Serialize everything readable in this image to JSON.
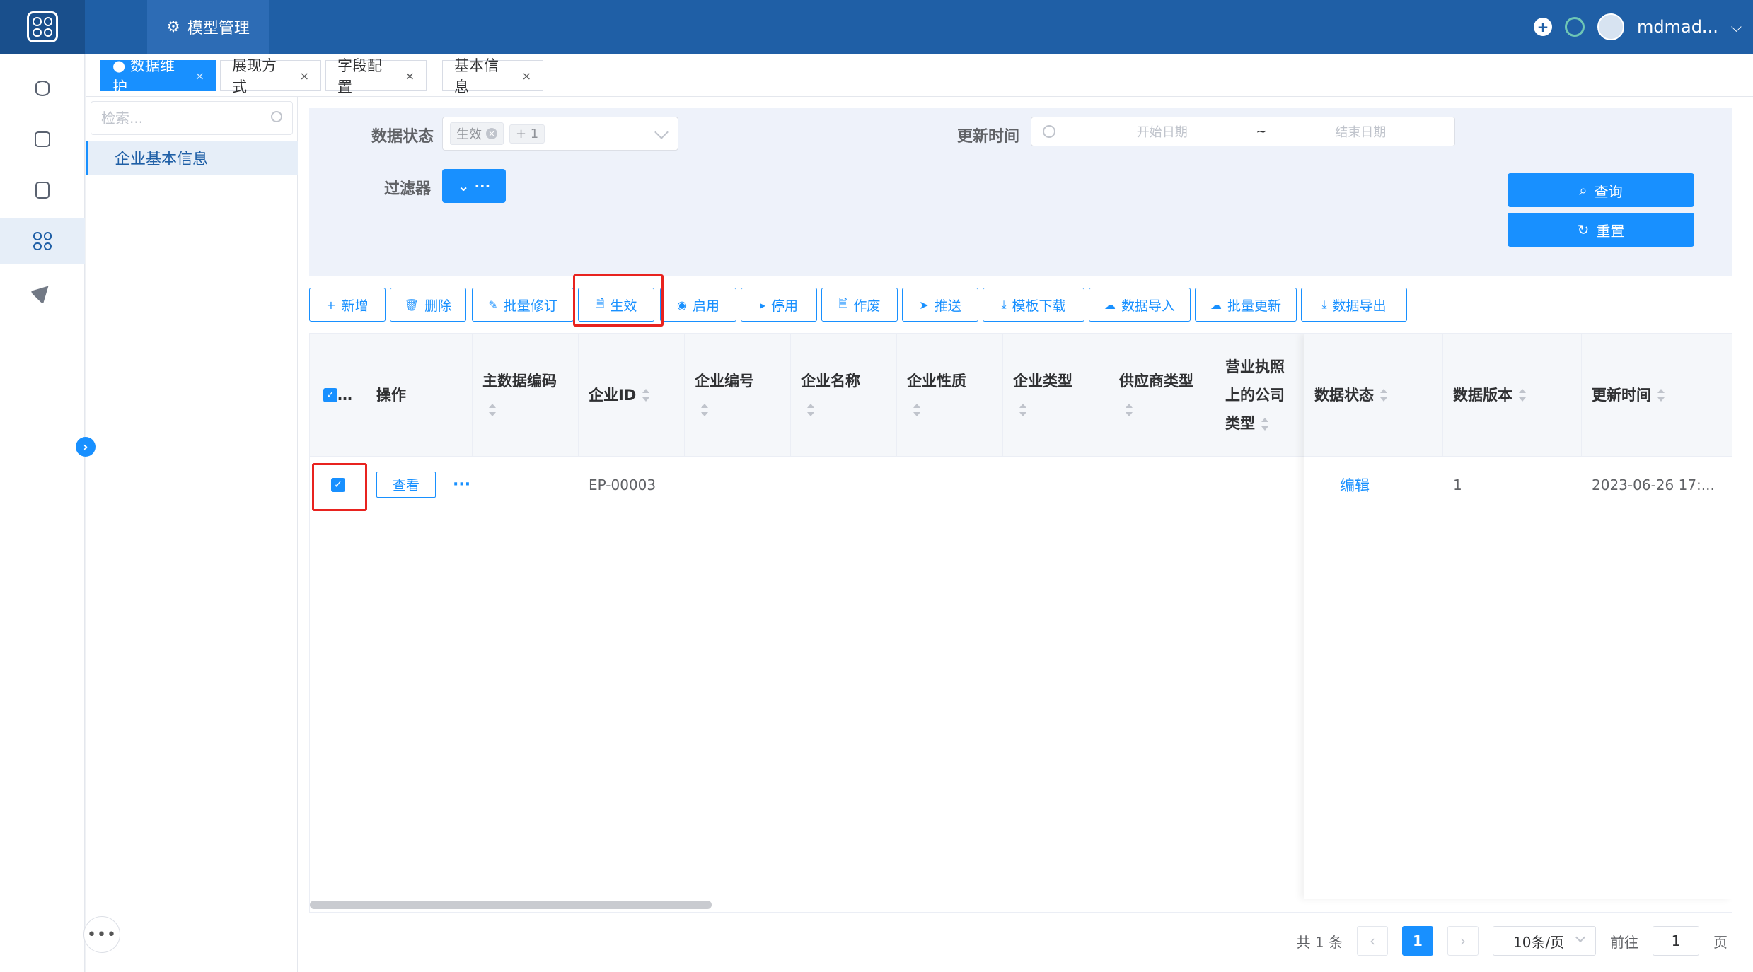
{
  "header": {
    "module_tab": "模型管理",
    "username": "mdmad...",
    "brand_color": "#1f5fa6"
  },
  "rail": {
    "icons": [
      "database-icon",
      "code-icon",
      "form-icon",
      "grid-icon",
      "send-icon"
    ],
    "active_index": 3
  },
  "tabs": [
    {
      "label": "● 数据维护",
      "active": true
    },
    {
      "label": "展现方式",
      "active": false
    },
    {
      "label": "字段配置",
      "active": false
    },
    {
      "label": "基本信息",
      "active": false
    }
  ],
  "tree": {
    "search_placeholder": "检索...",
    "nodes": [
      {
        "label": "企业基本信息",
        "selected": true
      }
    ]
  },
  "filter": {
    "status_label": "数据状态",
    "status_chip": "生效",
    "status_more": "+ 1",
    "filter_label": "过滤器",
    "filter_button": "⌄ ···",
    "time_label": "更新时间",
    "date_start_placeholder": "开始日期",
    "date_separator": "~",
    "date_end_placeholder": "结束日期",
    "query_button": "查询",
    "reset_button": "重置"
  },
  "toolbar": [
    {
      "icon": "+",
      "label": "新增"
    },
    {
      "icon": "🗑",
      "label": "删除"
    },
    {
      "icon": "✎",
      "label": "批量修订"
    },
    {
      "icon": "🗎",
      "label": "生效"
    },
    {
      "icon": "◉",
      "label": "启用"
    },
    {
      "icon": "▸",
      "label": "停用"
    },
    {
      "icon": "🗎",
      "label": "作废"
    },
    {
      "icon": "➤",
      "label": "推送"
    },
    {
      "icon": "⤓",
      "label": "模板下载"
    },
    {
      "icon": "☁",
      "label": "数据导入"
    },
    {
      "icon": "☁",
      "label": "批量更新"
    },
    {
      "icon": "⤓",
      "label": "数据导出"
    }
  ],
  "table": {
    "select_all_label": "…",
    "columns": [
      "操作",
      "主数据编码",
      "企业ID",
      "企业编号",
      "企业名称",
      "企业性质",
      "企业类型",
      "供应商类型",
      "营业执照上的公司类型",
      "数据状态",
      "数据版本",
      "更新时间"
    ],
    "rows": [
      {
        "checked": true,
        "view_label": "查看",
        "more_label": "···",
        "master_code": "",
        "enterprise_id": "EP-00003",
        "enterprise_no": "",
        "enterprise_name": "",
        "nature": "",
        "type": "",
        "supplier_type": "",
        "license_type": "",
        "status": "编辑",
        "version": "1",
        "updated_at": "2023-06-26 17:..."
      }
    ]
  },
  "pager": {
    "total": "共 1 条",
    "current_page": "1",
    "page_size": "10条/页",
    "goto_prefix": "前往",
    "goto_value": "1",
    "goto_suffix": "页"
  },
  "accent_color": "#1890ff",
  "highlight_color": "#e8231f"
}
